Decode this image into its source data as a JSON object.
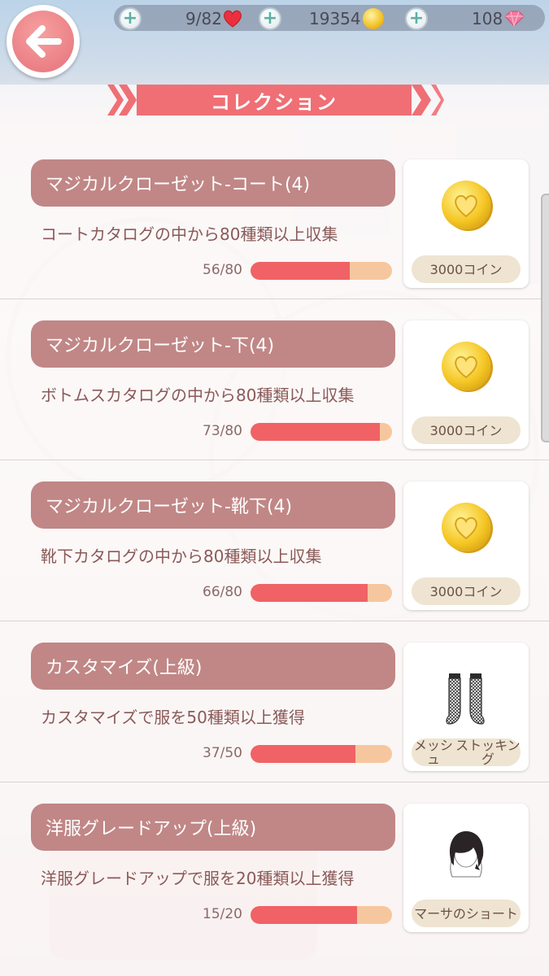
{
  "header": {
    "title": "コレクション",
    "resources": [
      {
        "name": "stamina",
        "value": "9/82",
        "icon": "heart-icon"
      },
      {
        "name": "coins",
        "value": "19354",
        "icon": "coin-icon"
      },
      {
        "name": "diamonds",
        "value": "108",
        "icon": "diamond-icon"
      }
    ]
  },
  "items": [
    {
      "title": "マジカルクローゼット-コート(4)",
      "desc": "コートカタログの中から80種類以上収集",
      "count": "56/80",
      "progress": 0.7,
      "reward": "3000コイン",
      "reward_icon": "coin-icon"
    },
    {
      "title": "マジカルクローゼット-下(4)",
      "desc": "ボトムスカタログの中から80種類以上収集",
      "count": "73/80",
      "progress": 0.9125,
      "reward": "3000コイン",
      "reward_icon": "coin-icon"
    },
    {
      "title": "マジカルクローゼット-靴下(4)",
      "desc": "靴下カタログの中から80種類以上収集",
      "count": "66/80",
      "progress": 0.825,
      "reward": "3000コイン",
      "reward_icon": "coin-icon"
    },
    {
      "title": "カスタマイズ(上級)",
      "desc": "カスタマイズで服を50種類以上獲得",
      "count": "37/50",
      "progress": 0.74,
      "reward": "メッシュストッキング",
      "reward_line1": "メッシュ",
      "reward_line2": "ストッキング",
      "reward_icon": "stocking-icon"
    },
    {
      "title": "洋服グレードアップ(上級)",
      "desc": "洋服グレードアップで服を20種類以上獲得",
      "count": "15/20",
      "progress": 0.75,
      "reward": "マーサのショート",
      "reward_line1": "マーサの",
      "reward_line2": "ショート",
      "reward_icon": "hair-icon"
    }
  ],
  "colors": {
    "accent": "#ef6f75",
    "pill": "#c08786",
    "bar_fill": "#f06266",
    "bar_track": "#f6c79e"
  }
}
